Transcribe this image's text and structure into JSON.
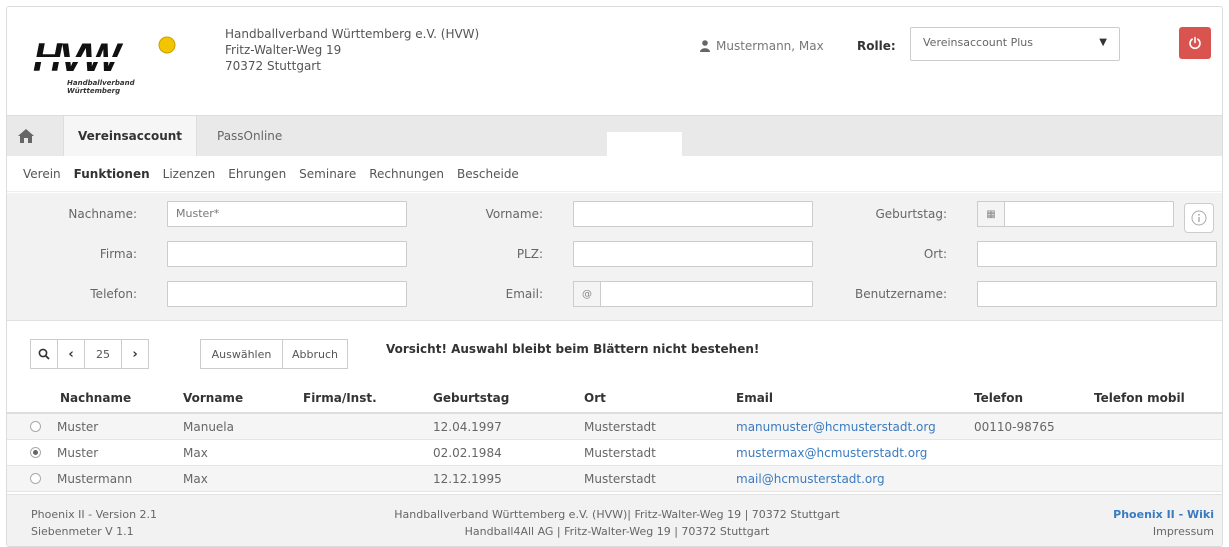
{
  "header": {
    "logo_text": "HVW",
    "logo_sub": "Handballverband Württemberg",
    "org_lines": [
      "Handballverband Württemberg e.V. (HVW)",
      "Fritz-Walter-Weg 19",
      "70372 Stuttgart"
    ],
    "user_name": "Mustermann, Max",
    "role_label": "Rolle:",
    "role_value": "Vereinsaccount Plus"
  },
  "tabs": {
    "active": "Vereinsaccount",
    "other": "PassOnline"
  },
  "subnav": [
    "Verein",
    "Funktionen",
    "Lizenzen",
    "Ehrungen",
    "Seminare",
    "Rechnungen",
    "Bescheide"
  ],
  "filter": {
    "nachname_label": "Nachname:",
    "nachname_value": "Muster*",
    "vorname_label": "Vorname:",
    "geburtstag_label": "Geburtstag:",
    "firma_label": "Firma:",
    "plz_label": "PLZ:",
    "ort_label": "Ort:",
    "telefon_label": "Telefon:",
    "email_label": "Email:",
    "benutzername_label": "Benutzername:"
  },
  "toolbar": {
    "page_size": "25",
    "select_label": "Auswählen",
    "cancel_label": "Abbruch",
    "warning": "Vorsicht! Auswahl bleibt beim Blättern nicht bestehen!"
  },
  "table": {
    "columns": [
      "Nachname",
      "Vorname",
      "Firma/Inst.",
      "Geburtstag",
      "Ort",
      "Email",
      "Telefon",
      "Telefon mobil"
    ],
    "rows": [
      {
        "nachname": "Muster",
        "vorname": "Manuela",
        "firma": "",
        "geburtstag": "12.04.1997",
        "ort": "Musterstadt",
        "email": "manumuster@hcmusterstadt.org",
        "telefon": "00110-98765",
        "mobil": "",
        "selected": false
      },
      {
        "nachname": "Muster",
        "vorname": "Max",
        "firma": "",
        "geburtstag": "02.02.1984",
        "ort": "Musterstadt",
        "email": "mustermax@hcmusterstadt.org",
        "telefon": "",
        "mobil": "",
        "selected": true
      },
      {
        "nachname": "Mustermann",
        "vorname": "Max",
        "firma": "",
        "geburtstag": "12.12.1995",
        "ort": "Musterstadt",
        "email": "mail@hcmusterstadt.org",
        "telefon": "",
        "mobil": "",
        "selected": false
      }
    ]
  },
  "footer": {
    "version": "Phoenix II - Version 2.1",
    "sub_version": "Siebenmeter V 1.1",
    "center_line1": "Handballverband Württemberg e.V. (HVW)| Fritz-Walter-Weg 19 | 70372 Stuttgart",
    "center_line2": "Handball4All AG | Fritz-Walter-Weg 19 | 70372 Stuttgart",
    "wiki": "Phoenix II - Wiki",
    "impressum": "Impressum"
  },
  "colors": {
    "accent": "#3a7bc0",
    "danger": "#d9534f",
    "logo_yellow": "#f2c500"
  }
}
